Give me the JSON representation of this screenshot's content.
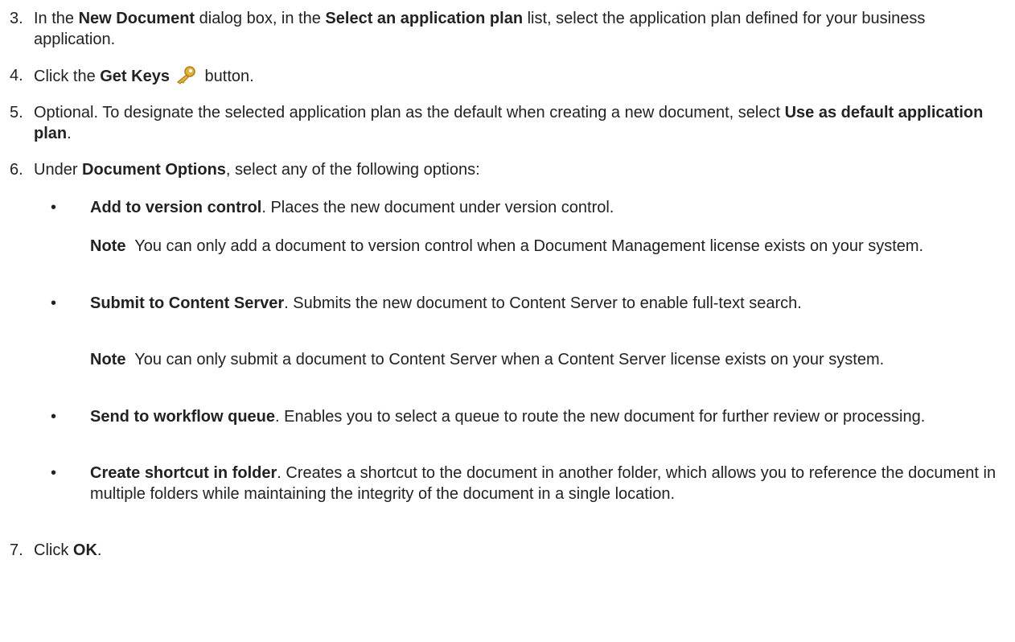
{
  "steps": [
    {
      "num": "3.",
      "parts": [
        "In the ",
        "New Document",
        " dialog box, in the ",
        "Select an application plan",
        " list, select the application plan defined for your business application."
      ]
    },
    {
      "num": "4.",
      "parts": [
        "Click the ",
        "Get Keys",
        " button."
      ]
    },
    {
      "num": "5.",
      "parts": [
        "Optional. To designate the selected application plan as the default when creating a new document, select ",
        "Use as default application plan",
        "."
      ]
    },
    {
      "num": "6.",
      "parts": [
        "Under ",
        "Document Options",
        ", select any of the following options:"
      ]
    },
    {
      "num": "7.",
      "parts": [
        "Click ",
        "OK",
        "."
      ]
    }
  ],
  "options": [
    {
      "bullet": "•",
      "title": "Add to version control",
      "desc": ". Places the new document under version control."
    },
    {
      "bullet": "•",
      "title": "Submit to Content Server",
      "desc": ". Submits the new document to Content Server to enable full-text search."
    },
    {
      "bullet": "•",
      "title": "Send to workflow queue",
      "desc": ". Enables you to select a queue to route the new document for further review or processing."
    },
    {
      "bullet": "•",
      "title": "Create shortcut in folder",
      "desc": ". Creates a shortcut to the document in another folder, which allows you to reference the document in multiple folders while maintaining the integrity of the document in a single location."
    }
  ],
  "notes": [
    {
      "label": "Note",
      "text": "  You can only add a document to version control when a Document Management license exists on your system."
    },
    {
      "label": "Note",
      "text": "  You can only submit a document to Content Server when a Content Server license exists on your system."
    }
  ],
  "icons": {
    "get_keys": "key-icon",
    "key_color": "#d9a62a"
  }
}
